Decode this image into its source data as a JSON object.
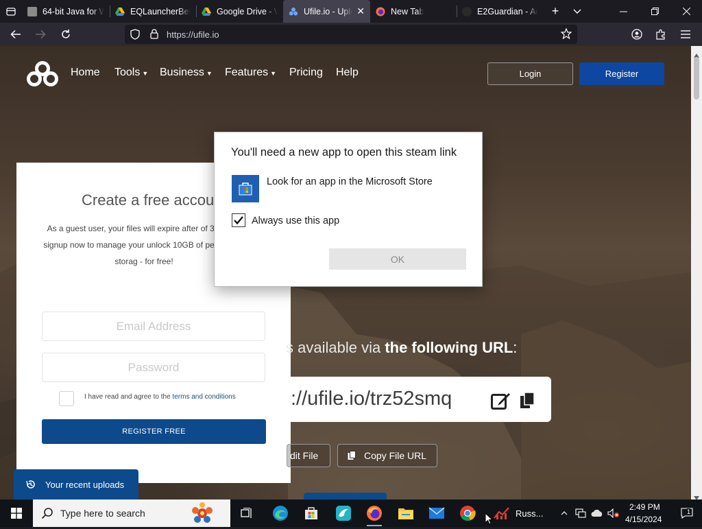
{
  "browser": {
    "tabs": [
      {
        "title": "64-bit Java for W"
      },
      {
        "title": "EQLauncherBeta"
      },
      {
        "title": "Google Drive - W"
      },
      {
        "title": "Ufile.io - Uplo"
      },
      {
        "title": "New Tab"
      },
      {
        "title": "E2Guardian - Ac"
      }
    ],
    "url": "https://ufile.io"
  },
  "site": {
    "nav": {
      "home": "Home",
      "tools": "Tools",
      "business": "Business",
      "features": "Features",
      "pricing": "Pricing",
      "help": "Help"
    },
    "login": "Login",
    "register": "Register",
    "signup": {
      "heading": "Create a free accou",
      "desc": "As a guest user, your files will expire after of 30 days, signup now to manage your unlock 10GB of permanent storag - for free!",
      "email_placeholder": "Email Address",
      "password_placeholder": "Password",
      "agree_prefix": "I have read and agree to the",
      "agree_link": "terms and conditions",
      "register_free": "REGISTER FREE"
    },
    "available_prefix": "s available via",
    "available_bold": "the following URL",
    "available_suffix": ":",
    "file_url": "://ufile.io/trz52smq",
    "edit_file": "dit File",
    "copy_file_url": "Copy File URL",
    "recent_uploads": "Your recent uploads"
  },
  "dialog": {
    "title": "You'll need a new app to open this steam link",
    "store_option": "Look for an app in the Microsoft Store",
    "always_use": "Always use this app",
    "always_use_checked": true,
    "ok": "OK"
  },
  "taskbar": {
    "search_placeholder": "Type here to search",
    "running_app": "Russ...",
    "time": "2:49 PM",
    "date": "4/15/2024",
    "notifications": "1"
  },
  "colors": {
    "brand_blue": "#0d47a1",
    "dialog_store_tile": "#1e5fb3"
  }
}
